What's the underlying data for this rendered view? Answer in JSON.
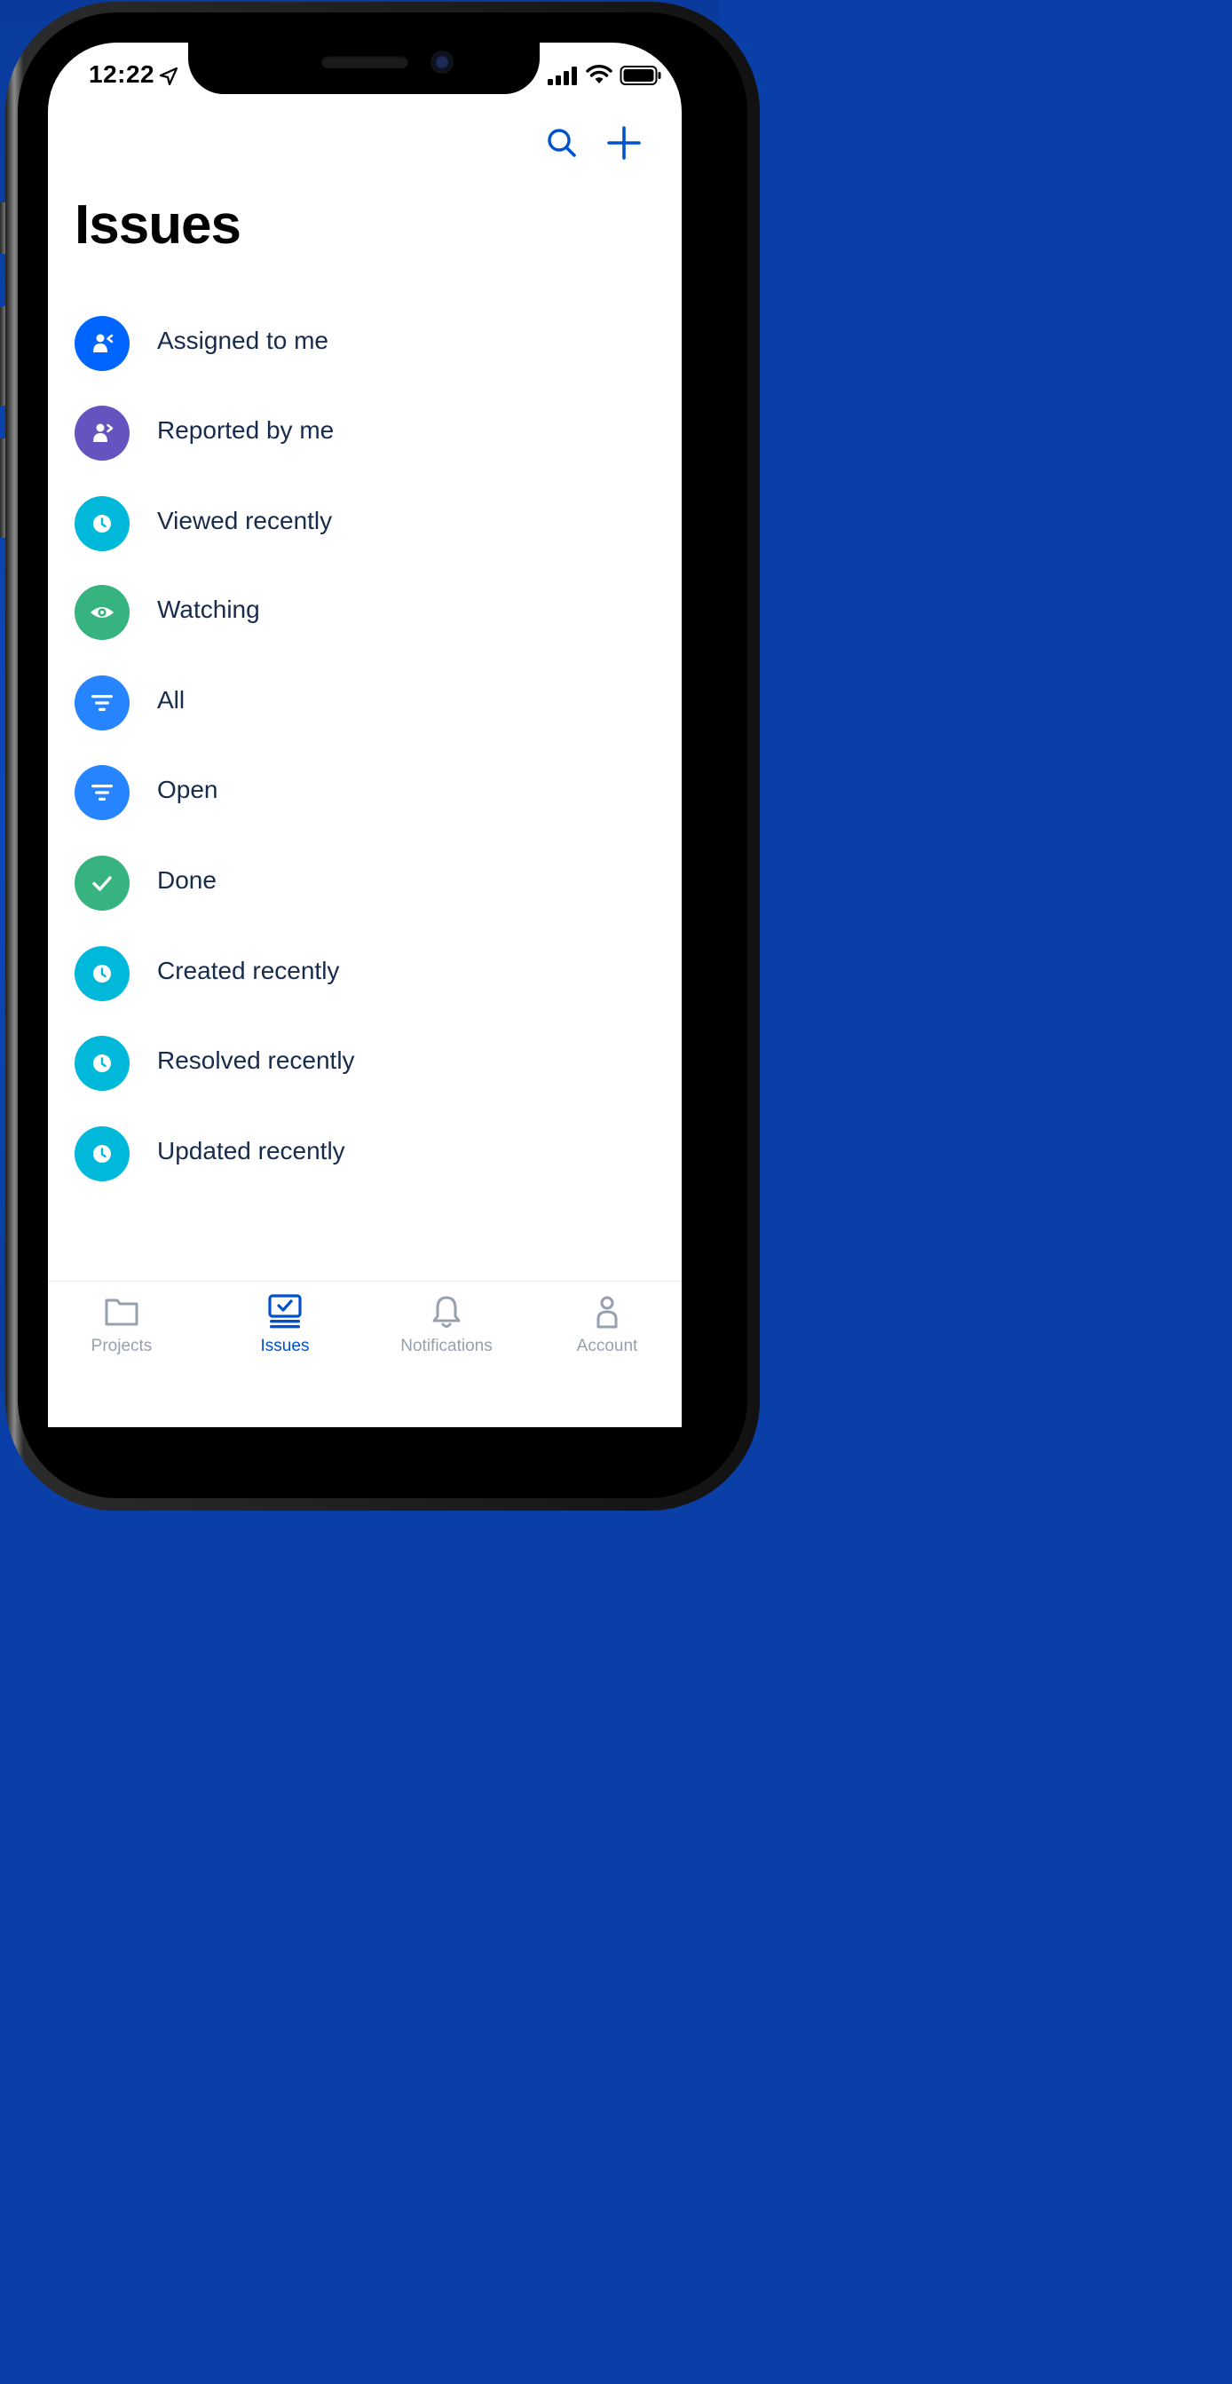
{
  "status_bar": {
    "time": "12:22"
  },
  "header": {
    "title": "Issues",
    "search_icon": "search-icon",
    "add_icon": "plus-icon"
  },
  "colors": {
    "brand_blue": "#0052cc",
    "text": "#172b4d",
    "inactive_tab": "#97a0af",
    "icon_blue": "#0065ff",
    "icon_purple": "#6554c0",
    "icon_cyan": "#00b8d9",
    "icon_green": "#36b37e",
    "icon_filter_blue": "#2684ff"
  },
  "filters": [
    {
      "label": "Assigned to me",
      "icon": "person-assigned-icon",
      "color": "#0065ff"
    },
    {
      "label": "Reported by me",
      "icon": "person-reported-icon",
      "color": "#6554c0"
    },
    {
      "label": "Viewed recently",
      "icon": "clock-icon",
      "color": "#00b8d9"
    },
    {
      "label": "Watching",
      "icon": "eye-icon",
      "color": "#36b37e"
    },
    {
      "label": "All",
      "icon": "filter-icon",
      "color": "#2684ff"
    },
    {
      "label": "Open",
      "icon": "filter-icon",
      "color": "#2684ff"
    },
    {
      "label": "Done",
      "icon": "check-icon",
      "color": "#36b37e"
    },
    {
      "label": "Created recently",
      "icon": "clock-icon",
      "color": "#00b8d9"
    },
    {
      "label": "Resolved recently",
      "icon": "clock-icon",
      "color": "#00b8d9"
    },
    {
      "label": "Updated recently",
      "icon": "clock-icon",
      "color": "#00b8d9"
    }
  ],
  "tabbar": {
    "tabs": [
      {
        "label": "Projects",
        "icon": "folder-icon",
        "active": false
      },
      {
        "label": "Issues",
        "icon": "issues-icon",
        "active": true
      },
      {
        "label": "Notifications",
        "icon": "bell-icon",
        "active": false
      },
      {
        "label": "Account",
        "icon": "person-icon",
        "active": false
      }
    ]
  }
}
